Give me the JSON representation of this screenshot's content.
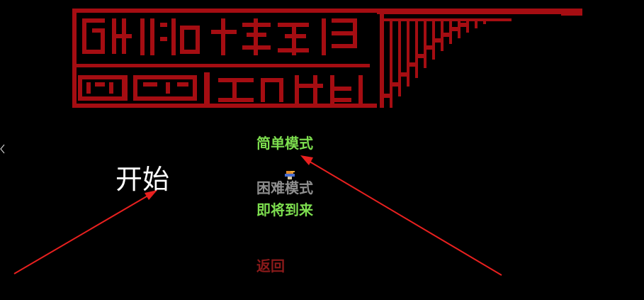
{
  "menu": {
    "start_label": "开始",
    "easy_mode": "简单模式",
    "hard_mode": "困难模式",
    "coming_soon": "即将到来",
    "back": "返回"
  },
  "colors": {
    "background": "#000000",
    "logo_red": "#a50d12",
    "active_green": "#7dde4f",
    "disabled_gray": "#8f8f8f",
    "back_red": "#8b1a1a",
    "arrow_red": "#e8201f"
  },
  "icons": {
    "logo": "pixel-red-game-title-logo",
    "sprite": "pixel-character-sprite-icon",
    "edge": "chevron-left-icon"
  }
}
